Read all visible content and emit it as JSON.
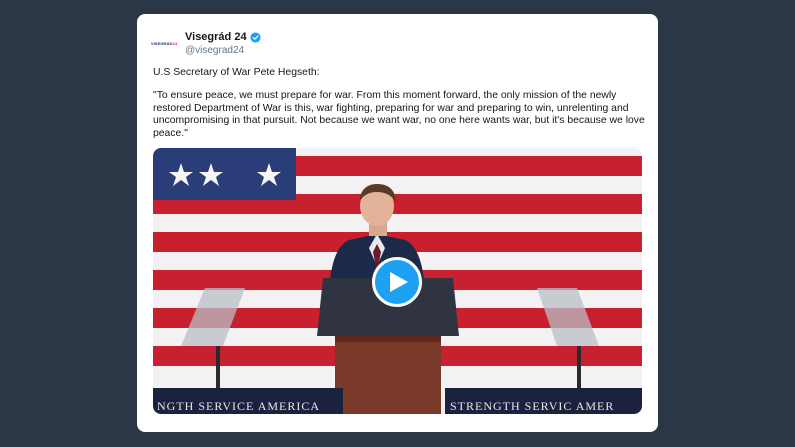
{
  "tweet": {
    "author_name": "Visegrád 24",
    "author_handle": "@visegrad24",
    "avatar_text_a": "VISEGRÁD",
    "avatar_text_b": "24",
    "line_intro": "U.S Secretary of War Pete Hegseth:",
    "line_quote": "\"To ensure peace, we must prepare for war. From this moment forward, the only mission of the newly restored Department of War is this, war fighting, preparing for war and preparing to win, unrelenting and uncompromising in that pursuit. Not because we want war, no one here wants war, but it's because we love peace.\""
  },
  "media": {
    "banner_left": "NGTH  SERVICE  AMERICA",
    "banner_right": "STRENGTH  SERVIC  AMER",
    "play_icon": "play-icon"
  },
  "colors": {
    "background": "#2c3746",
    "card": "#ffffff",
    "accent": "#1da1f2",
    "flag_red": "#c8202f",
    "flag_blue": "#2a3d78"
  }
}
